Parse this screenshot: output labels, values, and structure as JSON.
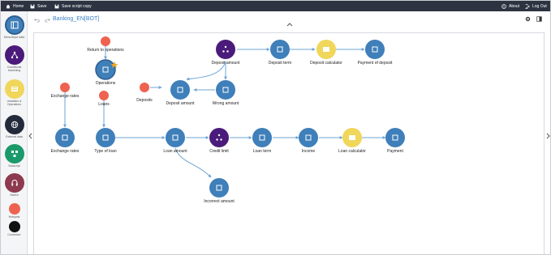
{
  "topbar": {
    "home": "Home",
    "save": "Save",
    "save_copy": "Save script copy",
    "about": "About",
    "logout": "Log Out"
  },
  "script_title": "Banking_EN[BOT]",
  "tools": [
    {
      "label": "Menu/Input data",
      "color": "#3f7fba",
      "icon": "menu-icon"
    },
    {
      "label": "Conditional branching",
      "color": "#4a1b7a",
      "icon": "branch-icon"
    },
    {
      "label": "Variables & Operations",
      "color": "#f0d65a",
      "icon": "variables-icon"
    },
    {
      "label": "External data",
      "color": "#232a3b",
      "icon": "globe-icon"
    },
    {
      "label": "Subscript",
      "color": "#1a9a6a",
      "icon": "subscript-icon"
    },
    {
      "label": "Switch",
      "color": "#8d3a4f",
      "icon": "headset-icon"
    },
    {
      "label": "Hotspots",
      "color": "#ee6350",
      "icon": "hotspot-icon"
    },
    {
      "label": "Connector",
      "color": "#111111",
      "icon": "connector-icon"
    }
  ],
  "colors": {
    "menu": "#3f7fba",
    "branch": "#4a1b7a",
    "calc": "#f0d65a",
    "hotspot": "#ee6350",
    "edge": "#6ea5d6"
  },
  "nodes": {
    "return_ops": "Return to operations",
    "operations": "Operations",
    "loans": "Loans",
    "exchange_hotspot": "Exchange rates",
    "exchange": "Exchange rates",
    "type_of_loan": "Type of loan",
    "loan_amount": "Loan amount",
    "credit_limit": "Credit limit",
    "loan_term": "Loan term",
    "income": "Income",
    "loan_calc": "Loan calculator",
    "payment": "Payment",
    "incorrect_amount": "Incorrect amount",
    "deposits_hotspot": "Deposits",
    "deposit_amount_menu": "Deposit amount",
    "deposit_amount_branch": "Deposit amount",
    "wrong_amount": "Wrong amount",
    "deposit_term": "Deposit term",
    "deposit_calc": "Deposit calculator",
    "payment_of_deposit": "Payment of deposit"
  }
}
